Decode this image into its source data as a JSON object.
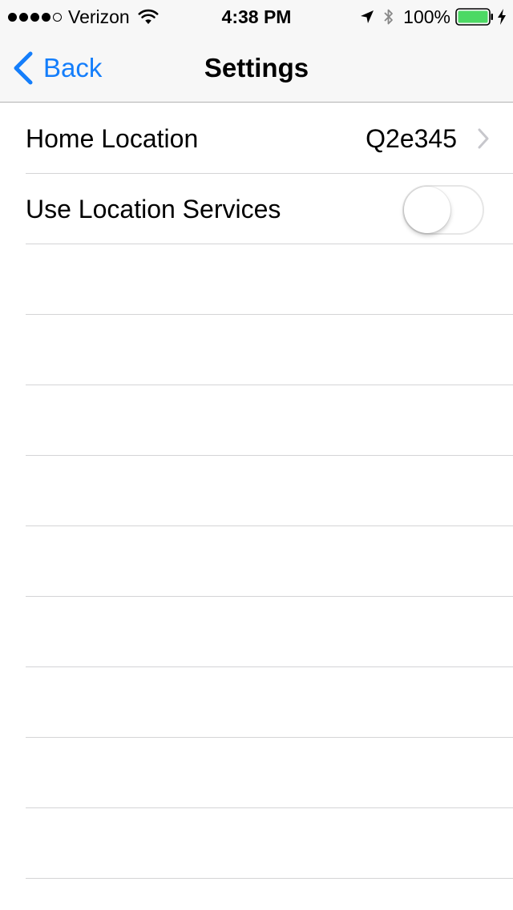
{
  "status_bar": {
    "carrier": "Verizon",
    "signal_bars": 4,
    "signal_total": 5,
    "time": "4:38 PM",
    "battery_percent": "100%",
    "battery_color": "#4cd964"
  },
  "nav": {
    "back_label": "Back",
    "title": "Settings",
    "accent_color": "#147efb"
  },
  "settings": {
    "home_location": {
      "label": "Home Location",
      "value": "Q2e345"
    },
    "location_services": {
      "label": "Use Location Services",
      "enabled": false
    }
  },
  "empty_rows": 9
}
